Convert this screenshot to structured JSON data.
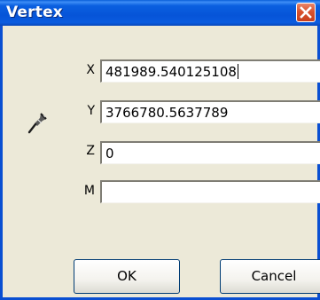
{
  "window": {
    "title": "Vertex",
    "close_icon": "close-x-icon"
  },
  "side_icon": "vertex-pin-icon",
  "fields": [
    {
      "label": "X",
      "value": "481989.540125108",
      "focused": true
    },
    {
      "label": "Y",
      "value": "3766780.5637789",
      "focused": false
    },
    {
      "label": "Z",
      "value": "0",
      "focused": false
    },
    {
      "label": "M",
      "value": "",
      "focused": false
    }
  ],
  "buttons": {
    "ok_label": "OK",
    "cancel_label": "Cancel"
  },
  "colors": {
    "titlebar": "#0a5fe0",
    "dialog_bg": "#ece9d8",
    "close_button": "#d9532f"
  }
}
